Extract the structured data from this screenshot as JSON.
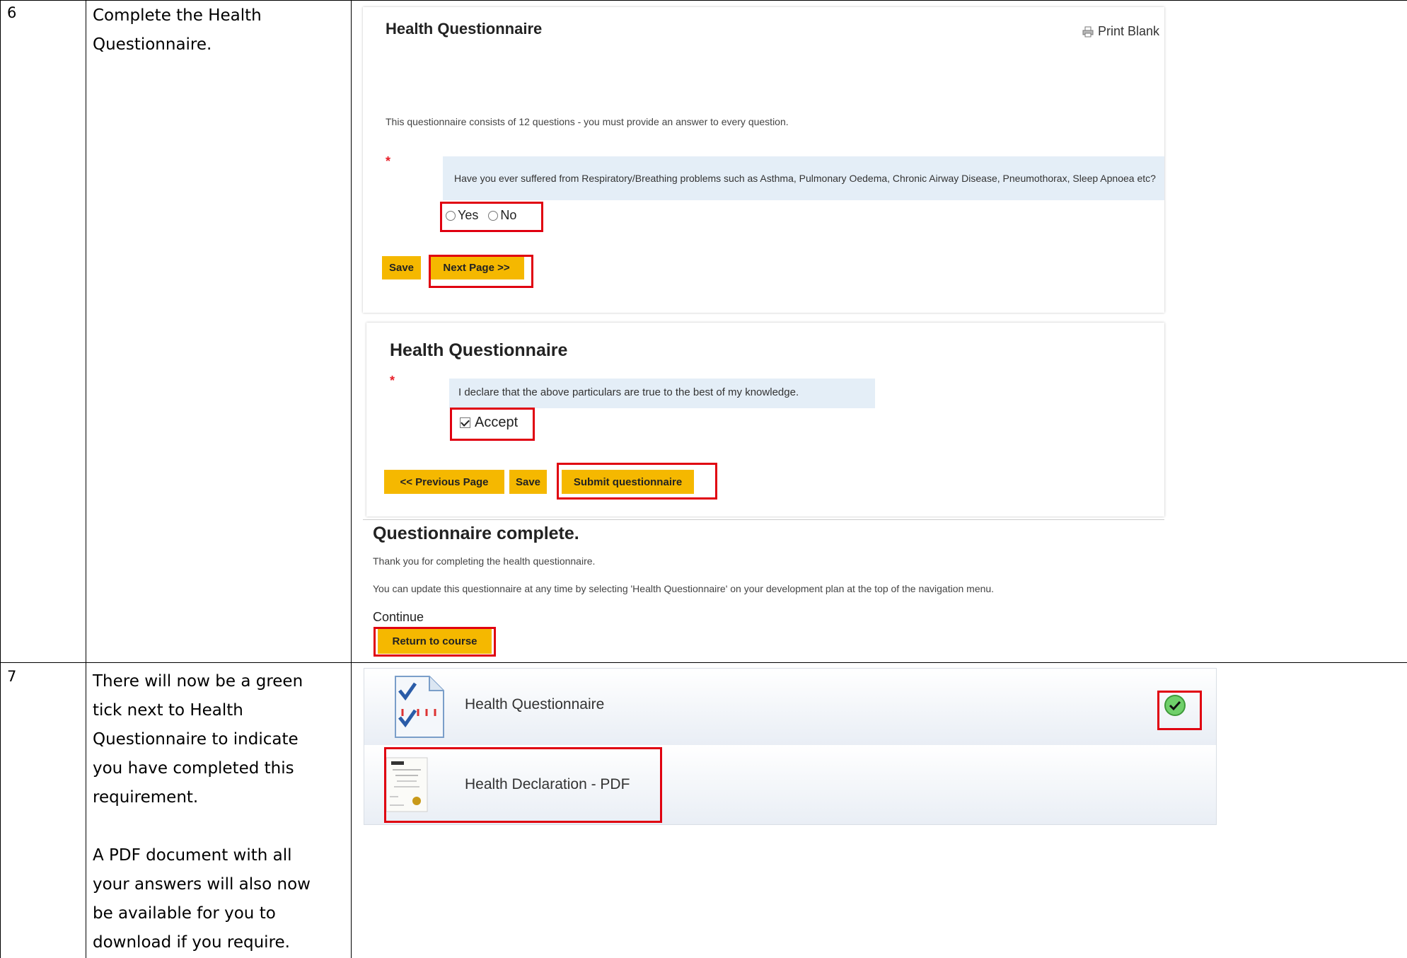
{
  "steps": [
    {
      "number": "6",
      "text": "Complete the Health\nQuestionnaire."
    },
    {
      "number": "7",
      "text": "There will now be a green\ntick next to Health\nQuestionnaire to indicate\nyou have completed this\nrequirement.\n\nA PDF document with all\nyour answers will also now\nbe available for you to\ndownload if you require."
    }
  ],
  "panel1": {
    "title": "Health Questionnaire",
    "print_label": "Print Blank",
    "intro": "This questionnaire consists of 12 questions - you must provide an answer to every question.",
    "asterisk": "*",
    "question": "Have you ever suffered from Respiratory/Breathing problems such as Asthma, Pulmonary Oedema, Chronic Airway Disease, Pneumothorax, Sleep Apnoea etc?",
    "option_yes": "Yes",
    "option_no": "No",
    "save_label": "Save",
    "next_label": "Next Page >>"
  },
  "panel2": {
    "title": "Health Questionnaire",
    "asterisk": "*",
    "declaration": "I declare that the above particulars are true to the best of my knowledge.",
    "accept_label": "Accept",
    "prev_label": "<< Previous Page",
    "save_label": "Save",
    "submit_label": "Submit questionnaire"
  },
  "panel3": {
    "title": "Questionnaire complete.",
    "thanks": "Thank you for completing the health questionnaire.",
    "update_note": "You can update this questionnaire at any time by selecting 'Health Questionnaire' on your development plan at the top of the navigation menu.",
    "continue_label": "Continue",
    "return_label": "Return to course"
  },
  "course_items": [
    {
      "label": "Health Questionnaire",
      "icon": "questionnaire-icon",
      "status": "complete"
    },
    {
      "label": "Health Declaration - PDF",
      "icon": "pdf-certificate-icon",
      "status": ""
    }
  ],
  "colors": {
    "accent_button": "#f5b800",
    "highlight_border": "#e00010",
    "question_bg": "#e4eef7",
    "tick_green": "#3cb34a"
  }
}
